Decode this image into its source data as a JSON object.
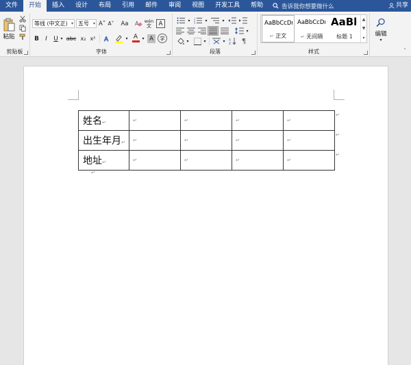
{
  "menubar": {
    "tabs": [
      "文件",
      "开始",
      "插入",
      "设计",
      "布局",
      "引用",
      "邮件",
      "审阅",
      "视图",
      "开发工具",
      "帮助"
    ],
    "active_tab": "开始",
    "tell_me": "告诉我你想要做什么",
    "share": "共享"
  },
  "ribbon": {
    "clipboard": {
      "paste": "粘贴",
      "label": "剪贴板"
    },
    "font": {
      "font_name": "等线 (中文正)",
      "font_size": "五号",
      "label": "字体",
      "bold": "B",
      "italic": "I",
      "underline": "U",
      "strike": "abc",
      "sub": "x₂",
      "sup": "x²",
      "grow": "A˄",
      "shrink": "A˅",
      "case": "Aa",
      "phonetic": "wén",
      "char_border": "A",
      "char_shade": "A",
      "circle": "字",
      "font_color": "A"
    },
    "paragraph": {
      "label": "段落"
    },
    "styles": {
      "label": "样式",
      "items": [
        {
          "preview": "AaBbCcDı",
          "name": "正文"
        },
        {
          "preview": "AaBbCcDı",
          "name": "无间隔"
        },
        {
          "preview": "AaBl",
          "name": "标题 1"
        }
      ]
    },
    "editing": {
      "label": "编辑"
    }
  },
  "document": {
    "table_rows": [
      {
        "label": "姓名"
      },
      {
        "label": "出生年月"
      },
      {
        "label": "地址"
      }
    ],
    "extra_columns": 4,
    "paragraph_mark": "↵"
  },
  "colors": {
    "menubar": "#2b579a",
    "ribbon": "#f3f3f3",
    "canvas": "#e6e6e6"
  }
}
